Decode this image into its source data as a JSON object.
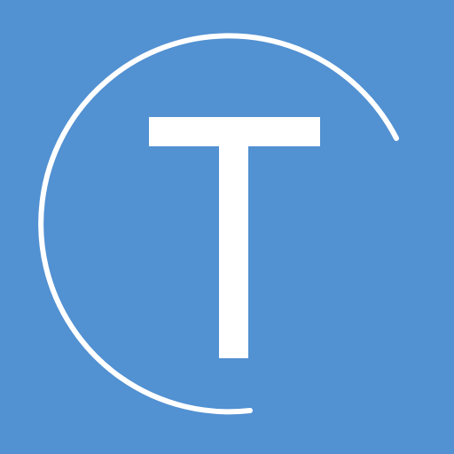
{
  "logo": {
    "name": "T circle logo",
    "letter": "T",
    "background_color": "#5291D2",
    "foreground_color": "#FFFFFF"
  }
}
